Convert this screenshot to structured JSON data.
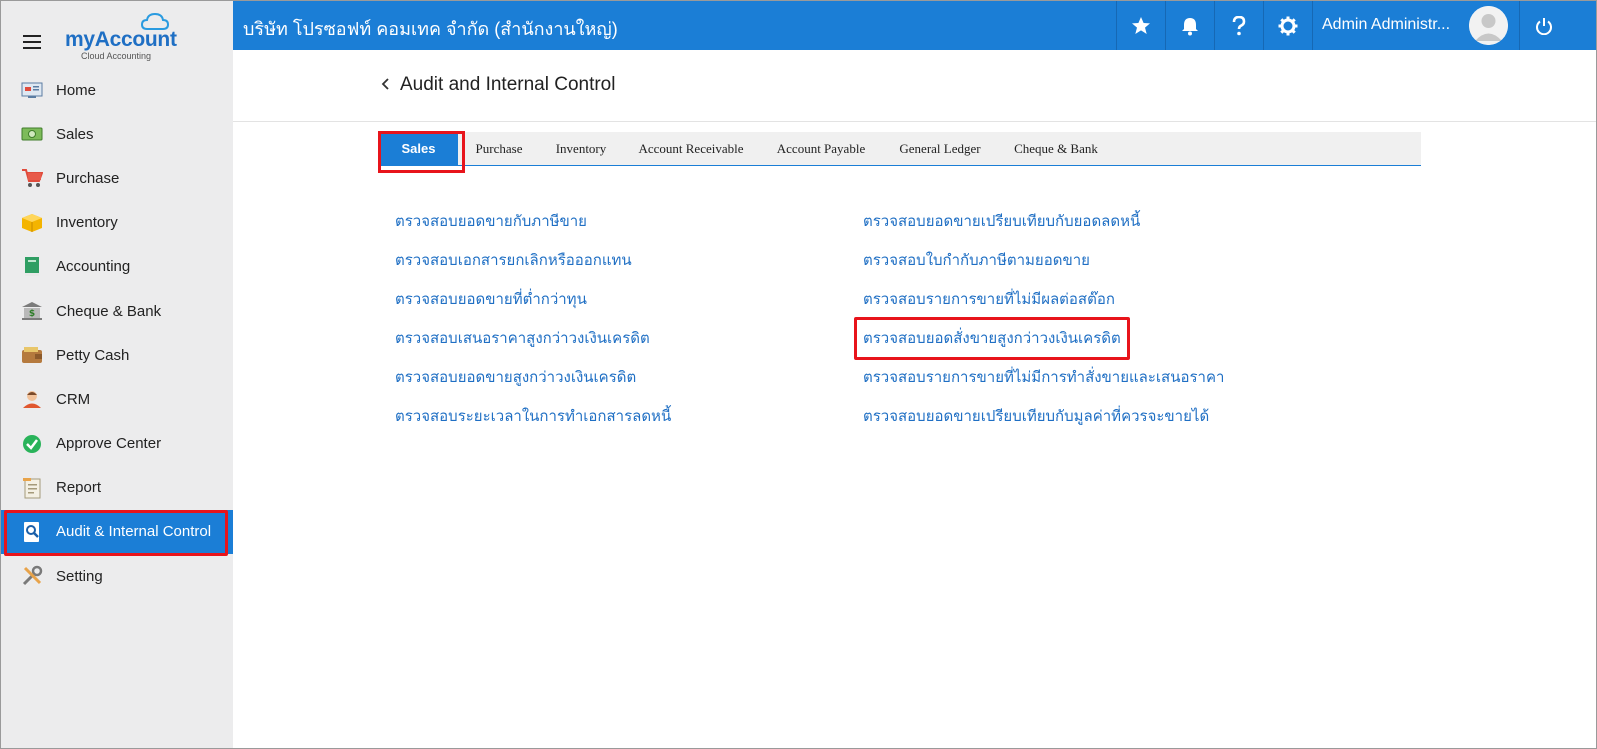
{
  "logo": {
    "name": "myAccount",
    "tagline": "Cloud Accounting"
  },
  "topbar": {
    "company": "บริษัท โปรซอฟท์ คอมเทค จำกัด (สำนักงานใหญ่)",
    "user_name": "Admin Administr...",
    "icons": [
      "star-icon",
      "bell-icon",
      "question-icon",
      "gear-icon",
      "power-icon"
    ]
  },
  "sidebar": {
    "items": [
      {
        "label": "Home",
        "icon": "home-icon"
      },
      {
        "label": "Sales",
        "icon": "money-icon"
      },
      {
        "label": "Purchase",
        "icon": "cart-icon"
      },
      {
        "label": "Inventory",
        "icon": "box-icon"
      },
      {
        "label": "Accounting",
        "icon": "book-icon"
      },
      {
        "label": "Cheque & Bank",
        "icon": "bank-icon"
      },
      {
        "label": "Petty Cash",
        "icon": "wallet-icon"
      },
      {
        "label": "CRM",
        "icon": "person-icon"
      },
      {
        "label": "Approve Center",
        "icon": "check-circle-icon"
      },
      {
        "label": "Report",
        "icon": "report-icon"
      },
      {
        "label": "Audit & Internal Control",
        "icon": "audit-icon",
        "active": true
      },
      {
        "label": "Setting",
        "icon": "tools-icon"
      }
    ]
  },
  "page": {
    "title": "Audit and Internal Control"
  },
  "tabs": [
    {
      "label": "Sales",
      "active": true
    },
    {
      "label": "Purchase"
    },
    {
      "label": "Inventory"
    },
    {
      "label": "Account Receivable"
    },
    {
      "label": "Account Payable"
    },
    {
      "label": "General Ledger"
    },
    {
      "label": "Cheque & Bank"
    }
  ],
  "links_left": [
    "ตรวจสอบยอดขายกับภาษีขาย",
    "ตรวจสอบเอกสารยกเลิกหรือออกแทน",
    "ตรวจสอบยอดขายที่ต่ำกว่าทุน",
    "ตรวจสอบเสนอราคาสูงกว่าวงเงินเครดิต",
    "ตรวจสอบยอดขายสูงกว่าวงเงินเครดิต",
    "ตรวจสอบระยะเวลาในการทำเอกสารลดหนี้"
  ],
  "links_right": [
    "ตรวจสอบยอดขายเปรียบเทียบกับยอดลดหนี้",
    "ตรวจสอบใบกำกับภาษีตามยอดขาย",
    "ตรวจสอบรายการขายที่ไม่มีผลต่อสต๊อก",
    "ตรวจสอบยอดสั่งขายสูงกว่าวงเงินเครดิต",
    "ตรวจสอบรายการขายที่ไม่มีการทำสั่งขายและเสนอราคา",
    "ตรวจสอบยอดขายเปรียบเทียบกับมูลค่าที่ควรจะขายได้"
  ],
  "colors": {
    "primary": "#1b7ed6",
    "highlight": "#e8141b",
    "link": "#1f6fc4",
    "sidebar_bg": "#ececed"
  }
}
